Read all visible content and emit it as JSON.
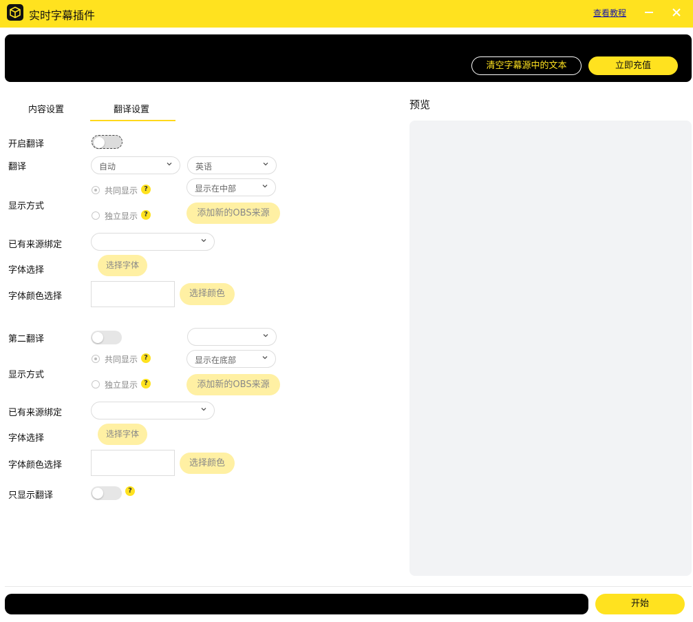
{
  "window": {
    "title": "实时字幕插件",
    "tutorial_link": "查看教程",
    "accent_color": "#ffe21f",
    "icons": [
      "app-logo-icon",
      "minimize-icon",
      "close-icon"
    ]
  },
  "banner": {
    "clear_button": "清空字幕源中的文本",
    "recharge_button": "立即充值"
  },
  "tabs": [
    {
      "label": "内容设置",
      "active": false
    },
    {
      "label": "翻译设置",
      "active": true
    }
  ],
  "preview": {
    "title": "预览"
  },
  "translation": {
    "enable_label": "开启翻译",
    "enable_on": false,
    "translate_label": "翻译",
    "source_lang": "自动",
    "target_lang": "英语",
    "display_mode_label": "显示方式",
    "display_position": "显示在中部",
    "radio_shared": "共同显示",
    "radio_separate": "独立显示",
    "selected_mode": "共同显示",
    "add_obs_button": "添加新的OBS来源",
    "bound_source_label": "已有来源绑定",
    "bound_source_value": "",
    "font_label": "字体选择",
    "font_button": "选择字体",
    "color_label": "字体颜色选择",
    "color_button": "选择颜色",
    "help_mark": "?"
  },
  "second_translation": {
    "enable_label": "第二翻译",
    "enable_on": false,
    "language_value": "",
    "display_mode_label": "显示方式",
    "display_position": "显示在底部",
    "radio_shared": "共同显示",
    "radio_separate": "独立显示",
    "selected_mode": "共同显示",
    "add_obs_button": "添加新的OBS来源",
    "bound_source_label": "已有来源绑定",
    "bound_source_value": "",
    "font_label": "字体选择",
    "font_button": "选择字体",
    "color_label": "字体颜色选择",
    "color_button": "选择颜色",
    "help_mark": "?"
  },
  "only_translation": {
    "label": "只显示翻译",
    "enable_on": false,
    "help_mark": "?"
  },
  "footer": {
    "start_button": "开始"
  }
}
